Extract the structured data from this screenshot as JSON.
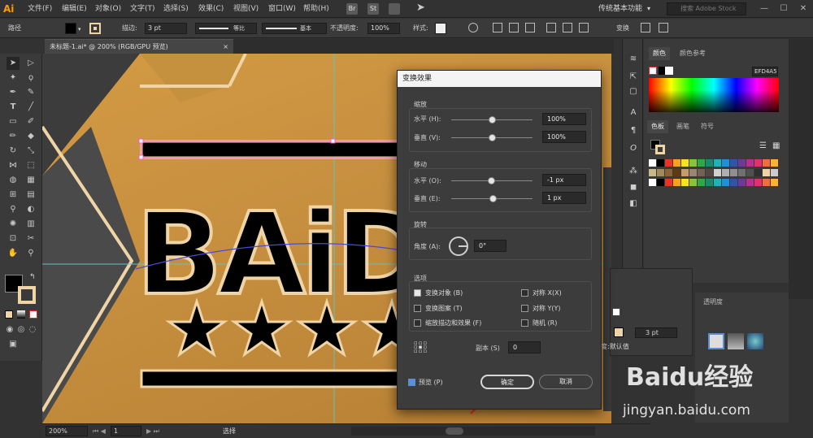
{
  "app": {
    "logo": "Ai"
  },
  "menubar": {
    "items": [
      "文件(F)",
      "编辑(E)",
      "对象(O)",
      "文字(T)",
      "选择(S)",
      "效果(C)",
      "视图(V)",
      "窗口(W)",
      "帮助(H)"
    ],
    "bridge_label": "Br",
    "stock_label": "St",
    "workspace": "传统基本功能",
    "search_placeholder": "搜索 Adobe Stock"
  },
  "controlbar": {
    "selection_type": "路径",
    "stroke_label": "描边:",
    "stroke_weight": "3 pt",
    "profile_label": "等比",
    "brush_label": "基本",
    "opacity_label": "不透明度:",
    "opacity_value": "100%",
    "style_label": "样式:",
    "transform_label": "变换",
    "fill_color": "#000000",
    "stroke_color": "#efd4a5"
  },
  "document": {
    "tab_title": "未标题-1.ai* @ 200% (RGB/GPU 预览)",
    "tab_close": "×",
    "logo_text": "BAiD"
  },
  "statusbar": {
    "zoom": "200%",
    "page": "1",
    "tool_status": "选择"
  },
  "dialog": {
    "title": "变换效果",
    "scale": {
      "label": "缩放",
      "horizontal_label": "水平 (H):",
      "horizontal_value": "100%",
      "vertical_label": "垂直 (V):",
      "vertical_value": "100%"
    },
    "move": {
      "label": "移动",
      "horizontal_label": "水平 (O):",
      "horizontal_value": "-1 px",
      "vertical_label": "垂直 (E):",
      "vertical_value": "1 px"
    },
    "rotate": {
      "label": "旋转",
      "angle_label": "角度 (A):",
      "angle_value": "0°"
    },
    "options": {
      "label": "选项",
      "transform_objects": {
        "label": "变换对象 (B)",
        "checked": true
      },
      "transform_patterns": {
        "label": "变换图案 (T)",
        "checked": false
      },
      "scale_strokes": {
        "label": "缩放描边和效果 (F)",
        "checked": false
      },
      "reflect_x": {
        "label": "对称 X(X)",
        "checked": false
      },
      "reflect_y": {
        "label": "对称 Y(Y)",
        "checked": false
      },
      "random": {
        "label": "随机 (R)",
        "checked": false
      }
    },
    "copies_label": "副本 (S)",
    "copies_value": "0",
    "preview": {
      "label": "预览 (P)",
      "checked": true
    },
    "ok_label": "确定",
    "cancel_label": "取消"
  },
  "color_panel": {
    "tab_color": "颜色",
    "tab_color_guide": "颜色参考",
    "hex_value": "EFD4A5"
  },
  "swatch_panel": {
    "tab_swatches": "色板",
    "tab_brushes": "画笔",
    "tab_symbols": "符号"
  },
  "transparency_panel": {
    "tab_label": "透明度",
    "stroke_value": "3 pt",
    "default_label": "度:默认值"
  },
  "watermark": {
    "brand": "Baidu经验",
    "url": "jingyan.baidu.com"
  },
  "colors": {
    "accent_orange": "#ff9a00",
    "artwork_tan": "#c99444",
    "outline_cream": "#efd4a5",
    "selection_magenta": "#ff4fd8",
    "arrow_red": "#e8322a"
  }
}
